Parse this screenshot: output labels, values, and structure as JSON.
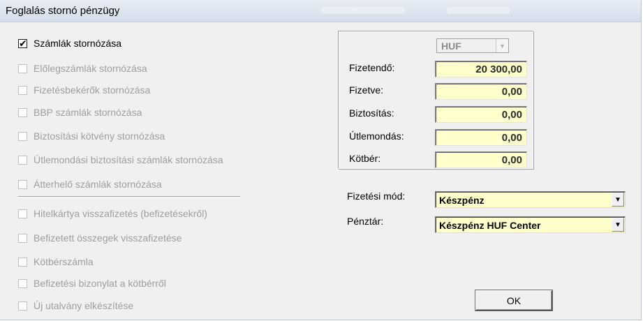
{
  "window": {
    "title": "Foglalás stornó pénzügy"
  },
  "options": [
    {
      "label": "Számlák stornózása",
      "checked": true,
      "enabled": true
    },
    {
      "label": "Előlegszámlák stornózása",
      "checked": false,
      "enabled": false
    },
    {
      "label": "Fizetésbekérők stornózása",
      "checked": false,
      "enabled": false
    },
    {
      "label": "BBP számlák stornózása",
      "checked": false,
      "enabled": false
    },
    {
      "label": "Biztosítási kötvény stornózása",
      "checked": false,
      "enabled": false
    },
    {
      "label": "Útlemondási biztosítási számlák stornózása",
      "checked": false,
      "enabled": false
    },
    {
      "label": "Átterhelő számlák stornózása",
      "checked": false,
      "enabled": false
    },
    {
      "label": "Hitelkártya visszafizetés (befizetésekről)",
      "checked": false,
      "enabled": false
    },
    {
      "label": "Befizetett összegek visszafizetése",
      "checked": false,
      "enabled": false
    },
    {
      "label": "Kötbérszámla",
      "checked": false,
      "enabled": false
    },
    {
      "label": "Befizetési bizonylat a kötbérről",
      "checked": false,
      "enabled": false
    },
    {
      "label": "Új utalvány elkészítése",
      "checked": false,
      "enabled": false
    }
  ],
  "amounts": {
    "currency": "HUF",
    "rows": [
      {
        "label": "Fizetendő:",
        "value": "20 300,00"
      },
      {
        "label": "Fizetve:",
        "value": "0,00"
      },
      {
        "label": "Biztosítás:",
        "value": "0,00"
      },
      {
        "label": "Útlemondás:",
        "value": "0,00"
      },
      {
        "label": "Kötbér:",
        "value": "0,00"
      }
    ]
  },
  "payment": {
    "method_label": "Fizetési mód:",
    "method_value": "Készpénz",
    "cashier_label": "Pénztár:",
    "cashier_value": "Készpénz HUF Center"
  },
  "buttons": {
    "ok": "OK"
  },
  "colors": {
    "field_bg": "#ffffcc",
    "dialog_bg": "#f0f0f0",
    "disabled_text": "#9e9e9e"
  }
}
